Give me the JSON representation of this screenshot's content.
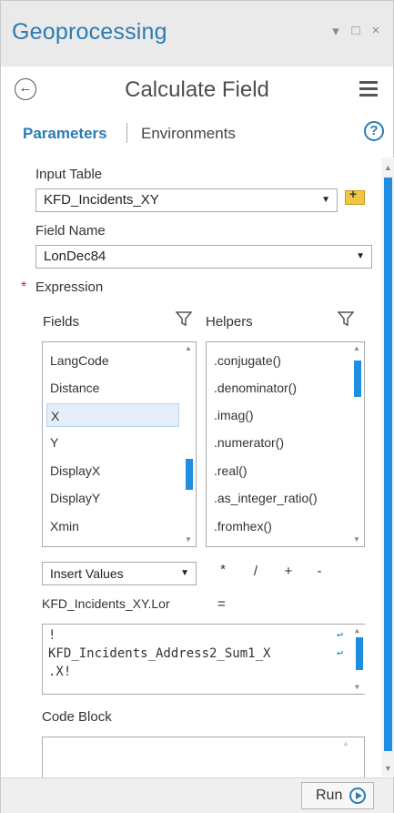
{
  "window": {
    "title": "Geoprocessing",
    "pin_glyph": "▾",
    "maximize_glyph": "□",
    "close_glyph": "×"
  },
  "header": {
    "back_glyph": "←",
    "title": "Calculate Field"
  },
  "tabs": {
    "parameters": "Parameters",
    "environments": "Environments",
    "help_glyph": "?"
  },
  "form": {
    "input_table_label": "Input Table",
    "input_table_value": "KFD_Incidents_XY",
    "field_name_label": "Field Name",
    "field_name_value": "LonDec84",
    "expression_label": "Expression",
    "required_mark": "*",
    "fields_label": "Fields",
    "helpers_label": "Helpers",
    "fields": [
      "LangCode",
      "Distance",
      "X",
      "Y",
      "DisplayX",
      "DisplayY",
      "Xmin"
    ],
    "selected_field": "X",
    "helpers": [
      ".conjugate()",
      ".denominator()",
      ".imag()",
      ".numerator()",
      ".real()",
      ".as_integer_ratio()",
      ".fromhex()"
    ],
    "insert_values_label": "Insert Values",
    "operators": [
      "*",
      "/",
      "+",
      "-"
    ],
    "expression_target": "KFD_Incidents_XY.Lor",
    "equals": "=",
    "expression_lines": [
      "!",
      "KFD_Incidents_Address2_Sum1_X",
      ".X!"
    ],
    "code_block_label": "Code Block"
  },
  "footer": {
    "run_label": "Run"
  },
  "colors": {
    "accent": "#2d7bb3",
    "scroll_thumb": "#1f8ee0",
    "required": "#d9242b"
  }
}
